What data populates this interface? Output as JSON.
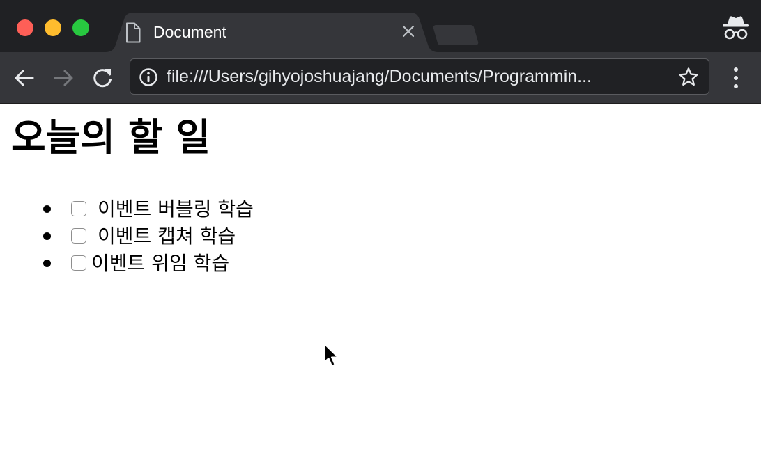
{
  "browser": {
    "tab": {
      "title": "Document"
    },
    "toolbar": {
      "url": "file:///Users/gihyojoshuajang/Documents/Programmin..."
    },
    "icons": {
      "window_close": "close-dot",
      "window_minimize": "minimize-dot",
      "window_maximize": "maximize-dot",
      "tab_icon": "document-icon",
      "tab_close": "x-icon",
      "incognito": "incognito-icon",
      "back": "arrow-left-icon",
      "forward": "arrow-right-icon",
      "reload": "reload-icon",
      "site_info": "info-icon",
      "bookmark": "star-icon",
      "menu": "kebab-menu-icon"
    },
    "colors": {
      "tab_strip": "#202124",
      "active_tab": "#35363a",
      "omnibox": "#202124",
      "close_dot": "#fe5f57",
      "minimize_dot": "#febc2e",
      "maximize_dot": "#28c840"
    }
  },
  "page": {
    "title": "오늘의 할 일",
    "todos": [
      {
        "label": "이벤트 버블링 학습",
        "checked": false
      },
      {
        "label": "이벤트 캡쳐 학습",
        "checked": false
      },
      {
        "label": "이벤트 위임 학습",
        "checked": false
      }
    ]
  }
}
